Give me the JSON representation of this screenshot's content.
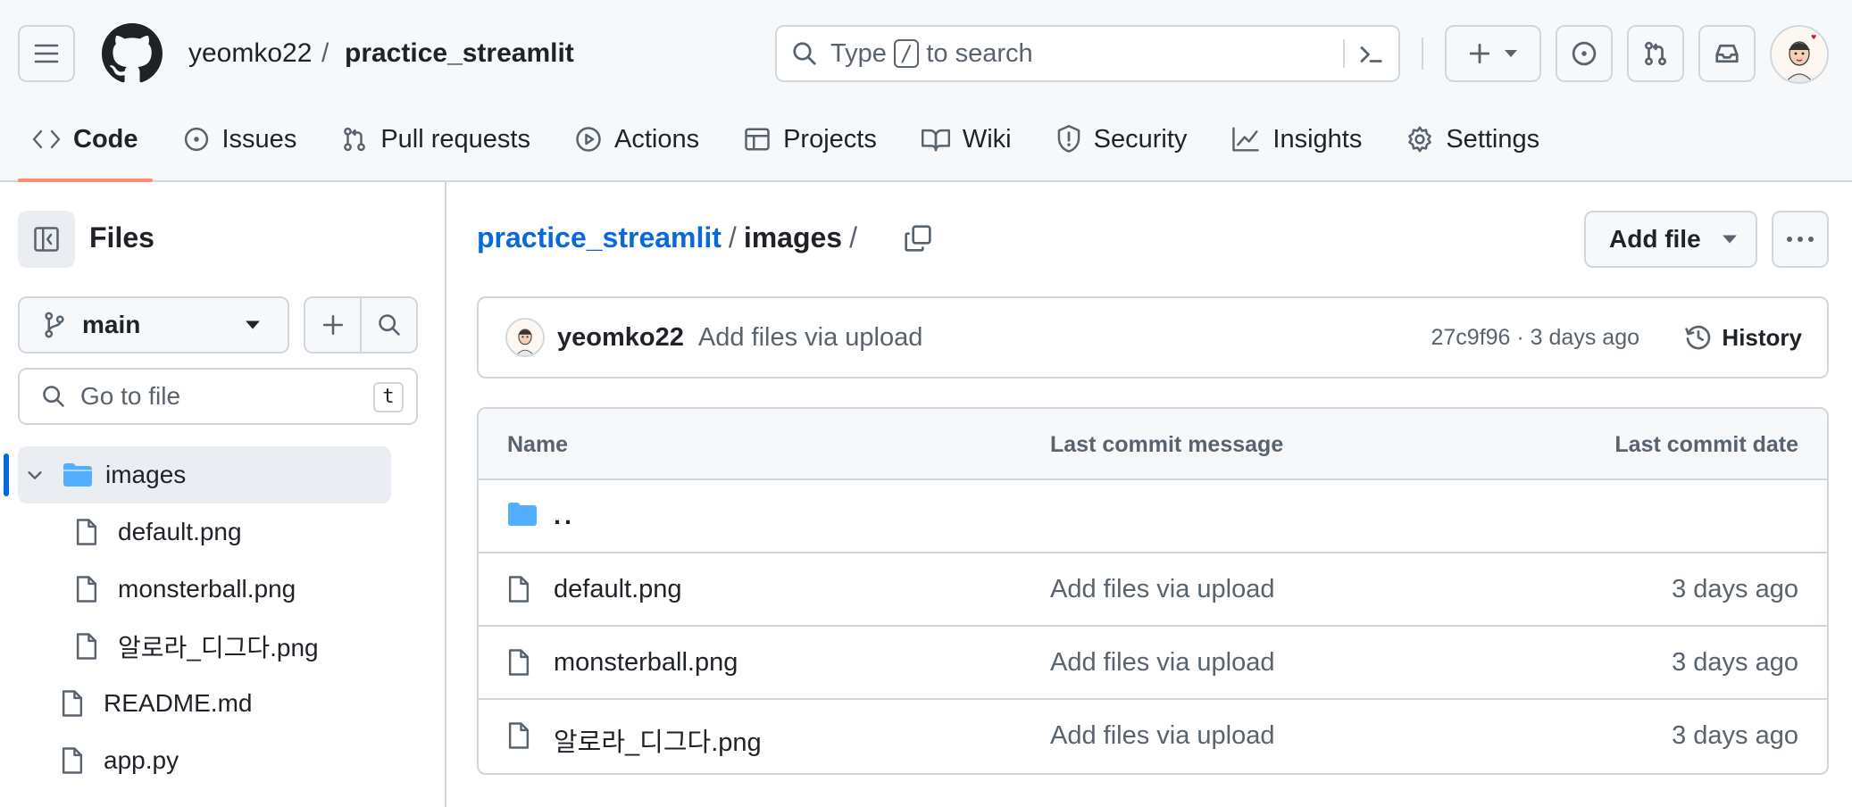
{
  "header": {
    "owner": "yeomko22",
    "separator": "/",
    "repo": "practice_streamlit",
    "search": {
      "prefix": "Type",
      "key": "/",
      "suffix": "to search"
    }
  },
  "tabs": [
    {
      "label": "Code",
      "icon": "code-icon",
      "active": true
    },
    {
      "label": "Issues",
      "icon": "issue-icon"
    },
    {
      "label": "Pull requests",
      "icon": "pull-request-icon"
    },
    {
      "label": "Actions",
      "icon": "play-icon"
    },
    {
      "label": "Projects",
      "icon": "table-icon"
    },
    {
      "label": "Wiki",
      "icon": "book-icon"
    },
    {
      "label": "Security",
      "icon": "shield-icon"
    },
    {
      "label": "Insights",
      "icon": "graph-icon"
    },
    {
      "label": "Settings",
      "icon": "gear-icon"
    }
  ],
  "sidebar": {
    "title": "Files",
    "branch": "main",
    "goto_placeholder": "Go to file",
    "goto_shortcut": "t",
    "tree": [
      {
        "label": "images",
        "type": "folder",
        "expanded": true,
        "selected": true
      },
      {
        "label": "default.png",
        "type": "file"
      },
      {
        "label": "monsterball.png",
        "type": "file"
      },
      {
        "label": "알로라_디그다.png",
        "type": "file"
      },
      {
        "label": "README.md",
        "type": "file"
      },
      {
        "label": "app.py",
        "type": "file"
      }
    ]
  },
  "main": {
    "path_repo": "practice_streamlit",
    "path_sep": "/",
    "path_dir": "images",
    "path_trailing": "/",
    "add_file_label": "Add file",
    "commit": {
      "author": "yeomko22",
      "message": "Add files via upload",
      "meta": "27c9f96 · 3 days ago",
      "history_label": "History"
    },
    "table": {
      "headers": {
        "name": "Name",
        "message": "Last commit message",
        "date": "Last commit date"
      },
      "parent_dir": "..",
      "rows": [
        {
          "name": "default.png",
          "message": "Add files via upload",
          "date": "3 days ago"
        },
        {
          "name": "monsterball.png",
          "message": "Add files via upload",
          "date": "3 days ago"
        },
        {
          "name": "알로라_디그다.png",
          "message": "Add files via upload",
          "date": "3 days ago"
        }
      ]
    }
  },
  "colors": {
    "accent": "#0969da",
    "active_tab_underline": "#fd8c73",
    "folder": "#54aeff",
    "border": "#d0d7de",
    "muted_text": "#59636e"
  }
}
